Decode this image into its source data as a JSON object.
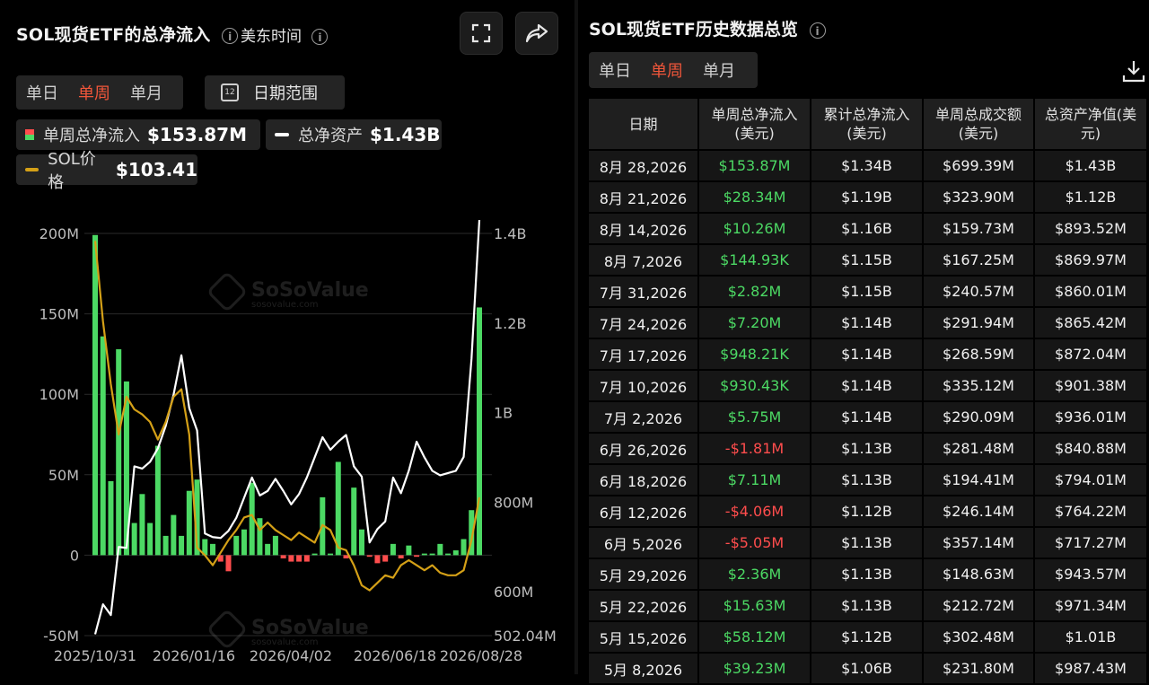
{
  "left": {
    "title": "SOL现货ETF的总净流入",
    "timezone": "美东时间",
    "period_tabs": [
      "单日",
      "单周",
      "单月"
    ],
    "active_period": "单周",
    "date_range_label": "日期范围",
    "calendar_icon_text": "12",
    "legend": {
      "inflow": {
        "label": "单周总净流入",
        "value": "$153.87M"
      },
      "assets": {
        "label": "总净资产",
        "value": "$1.43B"
      },
      "price": {
        "label": "SOL价格",
        "value": "$103.41"
      }
    }
  },
  "right": {
    "title": "SOL现货ETF历史数据总览",
    "period_tabs": [
      "单日",
      "单周",
      "单月"
    ],
    "active_period": "单周",
    "columns": [
      "日期",
      "单周总净流入\n(美元)",
      "累计总净流入\n(美元)",
      "单周总成交额\n(美元)",
      "总资产净值(美\n元)"
    ],
    "rows": [
      [
        "8月 28,2026",
        "$153.87M",
        "$1.34B",
        "$699.39M",
        "$1.43B"
      ],
      [
        "8月 21,2026",
        "$28.34M",
        "$1.19B",
        "$323.90M",
        "$1.12B"
      ],
      [
        "8月 14,2026",
        "$10.26M",
        "$1.16B",
        "$159.73M",
        "$893.52M"
      ],
      [
        "8月 7,2026",
        "$144.93K",
        "$1.15B",
        "$167.25M",
        "$869.97M"
      ],
      [
        "7月 31,2026",
        "$2.82M",
        "$1.15B",
        "$240.57M",
        "$860.01M"
      ],
      [
        "7月 24,2026",
        "$7.20M",
        "$1.14B",
        "$291.94M",
        "$865.42M"
      ],
      [
        "7月 17,2026",
        "$948.21K",
        "$1.14B",
        "$268.59M",
        "$872.04M"
      ],
      [
        "7月 10,2026",
        "$930.43K",
        "$1.14B",
        "$335.12M",
        "$901.38M"
      ],
      [
        "7月 2,2026",
        "$5.75M",
        "$1.14B",
        "$290.09M",
        "$936.01M"
      ],
      [
        "6月 26,2026",
        "-$1.81M",
        "$1.13B",
        "$281.48M",
        "$840.88M"
      ],
      [
        "6月 18,2026",
        "$7.11M",
        "$1.13B",
        "$194.41M",
        "$794.01M"
      ],
      [
        "6月 12,2026",
        "-$4.06M",
        "$1.12B",
        "$246.14M",
        "$764.22M"
      ],
      [
        "6月 5,2026",
        "-$5.05M",
        "$1.13B",
        "$357.14M",
        "$717.27M"
      ],
      [
        "5月 29,2026",
        "$2.36M",
        "$1.13B",
        "$148.63M",
        "$943.57M"
      ],
      [
        "5月 22,2026",
        "$15.63M",
        "$1.13B",
        "$212.72M",
        "$971.34M"
      ],
      [
        "5月 15,2026",
        "$58.12M",
        "$1.12B",
        "$302.48M",
        "$1.01B"
      ],
      [
        "5月 8,2026",
        "$39.23M",
        "$1.06B",
        "$231.80M",
        "$987.43M"
      ]
    ]
  },
  "watermark": {
    "brand": "SoSoValue",
    "site": "sosovalue.com"
  },
  "colors": {
    "positive": "#4cd964",
    "negative": "#ff4d4d",
    "price_line": "#d4a017",
    "assets_line": "#ffffff",
    "active_tab": "#f0563a"
  },
  "chart_data": {
    "type": "bar+line",
    "x_tick_labels": [
      "2025/10/31",
      "2026/01/16",
      "2026/04/02",
      "2026/06/18",
      "2026/08/28"
    ],
    "y_left_ticks": [
      "200M",
      "150M",
      "100M",
      "50M",
      "0",
      "-50M"
    ],
    "y_left_range": [
      -50,
      200
    ],
    "y_right_ticks": [
      "1.4B",
      "1.2B",
      "1B",
      "800M",
      "600M",
      "502.04M"
    ],
    "y_right_range": [
      502.04,
      1400
    ],
    "series": [
      {
        "name": "单周总净流入",
        "unit": "M USD",
        "values": [
          199,
          136,
          46,
          128,
          108,
          20,
          38,
          20,
          68,
          12,
          25,
          12,
          40,
          47,
          10,
          7,
          -4,
          -10,
          12,
          16,
          45,
          23,
          7,
          12,
          -2,
          -4,
          -4,
          -4,
          1,
          36,
          1,
          58,
          -2,
          42,
          16,
          -1,
          -5,
          -4,
          7,
          -2,
          6,
          -1,
          1,
          1,
          7,
          1,
          3,
          10,
          28,
          154
        ]
      },
      {
        "name": "总净资产",
        "unit": "M USD",
        "values": [
          505,
          572,
          548,
          700,
          698,
          880,
          875,
          890,
          920,
          970,
          1040,
          1128,
          1010,
          960,
          730,
          722,
          720,
          736,
          765,
          810,
          855,
          815,
          825,
          852,
          825,
          795,
          818,
          855,
          900,
          945,
          917,
          935,
          950,
          880,
          857,
          710,
          740,
          757,
          855,
          820,
          870,
          935,
          900,
          870,
          860,
          865,
          870,
          901,
          1120,
          1430
        ]
      },
      {
        "name": "SOL价格",
        "unit": "USD",
        "values": [
          207,
          175,
          150,
          130,
          145,
          140,
          138,
          135,
          128,
          135,
          145,
          148,
          130,
          85,
          82,
          78,
          83,
          88,
          92,
          97,
          98,
          92,
          95,
          92,
          90,
          88,
          91,
          89,
          87,
          94,
          92,
          85,
          84,
          78,
          70,
          68,
          71,
          74,
          73,
          78,
          80,
          78,
          76,
          78,
          75,
          74,
          74,
          76,
          88,
          105
        ]
      }
    ]
  }
}
